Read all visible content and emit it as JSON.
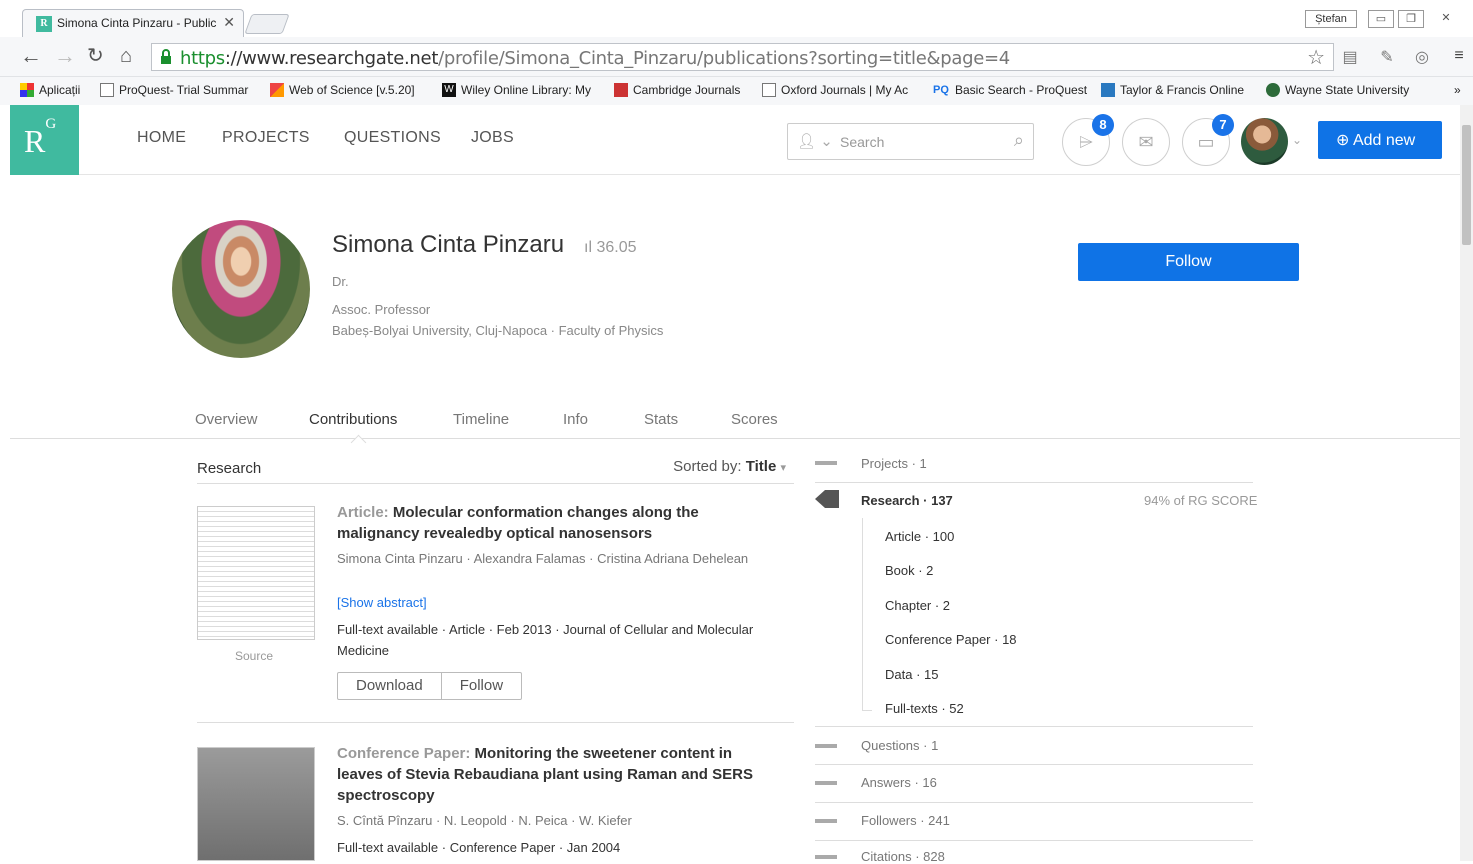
{
  "browser": {
    "tab_title": "Simona Cinta Pinzaru - Public",
    "user_badge": "Ștefan",
    "url_scheme": "https",
    "url_domain": "://www.researchgate.net",
    "url_path": "/profile/Simona_Cinta_Pinzaru/publications?sorting=title&page=4",
    "bookmarks": [
      {
        "label": "Aplicații"
      },
      {
        "label": "ProQuest- Trial Summar"
      },
      {
        "label": "Web of Science [v.5.20]"
      },
      {
        "label": "Wiley Online Library: My"
      },
      {
        "label": "Cambridge Journals"
      },
      {
        "label": "Oxford Journals | My Ac"
      },
      {
        "label": "Basic Search - ProQuest"
      },
      {
        "label": "Taylor & Francis Online"
      },
      {
        "label": "Wayne State University"
      }
    ],
    "more": "»"
  },
  "header": {
    "logo": "R",
    "logo_sup": "G",
    "nav": [
      "HOME",
      "PROJECTS",
      "QUESTIONS",
      "JOBS"
    ],
    "search_placeholder": "Search",
    "notif_count": "8",
    "msg_count": "7",
    "add_new": "Add new"
  },
  "profile": {
    "name": "Simona Cinta Pinzaru",
    "score": "36.05",
    "degree": "Dr.",
    "position": "Assoc. Professor",
    "affiliation": "Babeș-Bolyai University, Cluj-Napoca · Faculty of Physics",
    "follow": "Follow"
  },
  "tabs": [
    "Overview",
    "Contributions",
    "Timeline",
    "Info",
    "Stats",
    "Scores"
  ],
  "list": {
    "heading": "Research",
    "sorted_label": "Sorted by:",
    "sorted_value": "Title",
    "items": [
      {
        "type": "Article:",
        "title": "Molecular conformation changes along the malignancy revealedby optical nanosensors",
        "authors": "Simona Cinta Pinzaru · Alexandra Falamas · Cristina Adriana Dehelean",
        "abstract_link": "[Show abstract]",
        "meta": "Full-text available · Article · Feb 2013 · Journal of Cellular and Molecular Medicine",
        "thumb_label": "Source",
        "download": "Download",
        "follow": "Follow"
      },
      {
        "type": "Conference Paper:",
        "title": "Monitoring the sweetener content in leaves of Stevia Rebaudiana plant using Raman and SERS spectroscopy",
        "authors": "S. Cîntă Pînzaru · N. Leopold · N. Peica · W. Kiefer",
        "meta": "Full-text available · Conference Paper · Jan 2004"
      }
    ]
  },
  "sidebar": {
    "projects": "Projects · 1",
    "research": "Research · 137",
    "research_pct": "94% of RG SCORE",
    "sub": [
      "Article · 100",
      "Book · 2",
      "Chapter · 2",
      "Conference Paper · 18",
      "Data · 15",
      "Full-texts · 52"
    ],
    "questions": "Questions · 1",
    "answers": "Answers · 16",
    "followers": "Followers · 241",
    "citations": "Citations · 828"
  }
}
